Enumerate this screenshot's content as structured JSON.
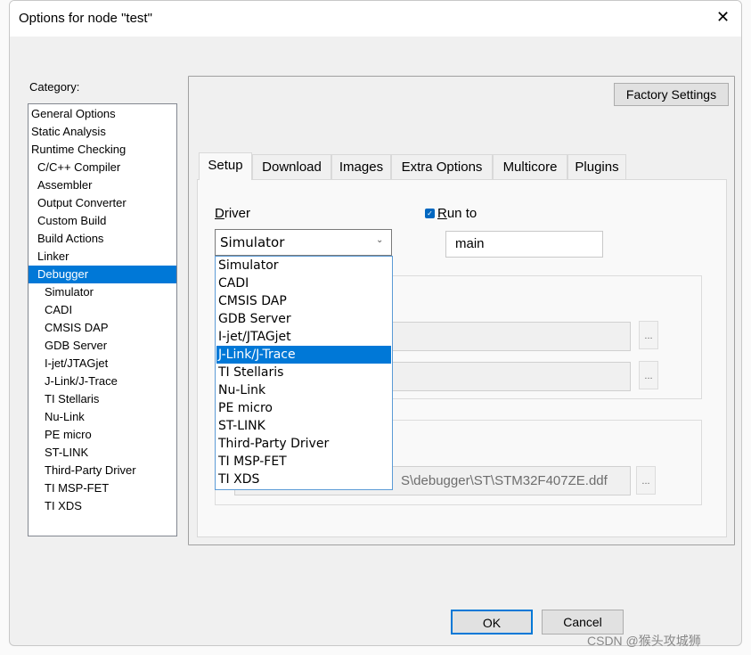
{
  "window": {
    "title": "Options for node \"test\"",
    "close_icon": "close-icon"
  },
  "category": {
    "label": "Category:",
    "items": [
      "General Options",
      "Static Analysis",
      "Runtime Checking",
      "C/C++ Compiler",
      "Assembler",
      "Output Converter",
      "Custom Build",
      "Build Actions",
      "Linker",
      "Debugger",
      "Simulator",
      "CADI",
      "CMSIS DAP",
      "GDB Server",
      "I-jet/JTAGjet",
      "J-Link/J-Trace",
      "TI Stellaris",
      "Nu-Link",
      "PE micro",
      "ST-LINK",
      "Third-Party Driver",
      "TI MSP-FET",
      "TI XDS"
    ],
    "selected": "Debugger"
  },
  "factory_settings": "Factory Settings",
  "tabs": [
    "Setup",
    "Download",
    "Images",
    "Extra Options",
    "Multicore",
    "Plugins"
  ],
  "active_tab": "Setup",
  "setup": {
    "driver_label": "Driver",
    "driver_value": "Simulator",
    "driver_options": [
      "Simulator",
      "CADI",
      "CMSIS DAP",
      "GDB Server",
      "I-jet/JTAGjet",
      "J-Link/J-Trace",
      "TI Stellaris",
      "Nu-Link",
      "PE micro",
      "ST-LINK",
      "Third-Party Driver",
      "TI MSP-FET",
      "TI XDS"
    ],
    "highlighted_option": "J-Link/J-Trace",
    "run_to_label": "Run to",
    "run_to_checked": true,
    "run_to_value": "main",
    "browse_label": "...",
    "device_file_visible": "S\\debugger\\ST\\STM32F407ZE.ddf"
  },
  "buttons": {
    "ok": "OK",
    "cancel": "Cancel"
  },
  "watermark": "CSDN @猴头攻城狮",
  "colors": {
    "selection": "#0078d7",
    "dialog_bg": "#f0f0f0"
  }
}
